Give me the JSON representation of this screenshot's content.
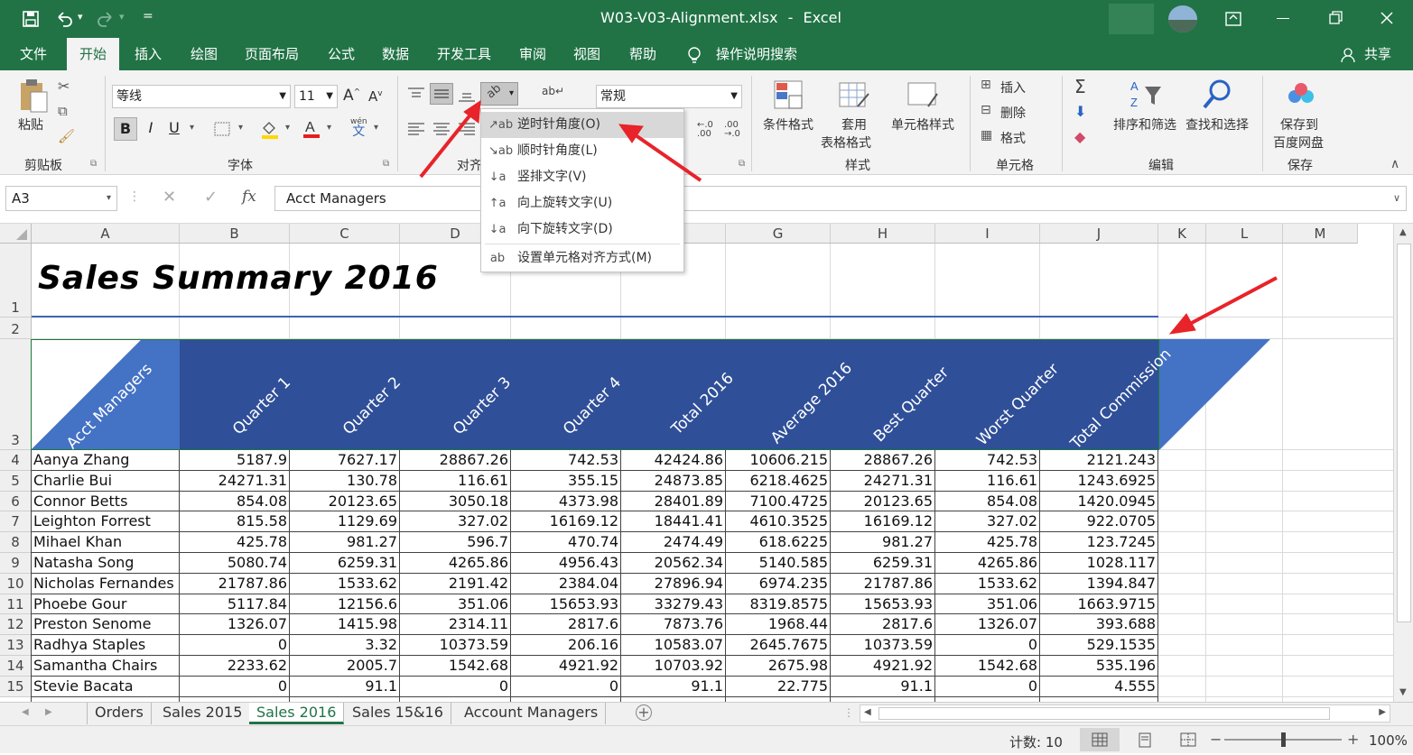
{
  "titlebar": {
    "filename": "W03-V03-Alignment.xlsx",
    "sep": "-",
    "app": "Excel",
    "quick_more": "="
  },
  "tabs": [
    "文件",
    "开始",
    "插入",
    "绘图",
    "页面布局",
    "公式",
    "数据",
    "开发工具",
    "审阅",
    "视图",
    "帮助"
  ],
  "tell_me": "操作说明搜索",
  "share": "共享",
  "ribbon": {
    "paste": "粘贴",
    "clipboard": "剪贴板",
    "font_name": "等线",
    "font_size": "11",
    "font_group": "字体",
    "bold": "B",
    "italic": "I",
    "underline": "U",
    "phonetic_top": "wén",
    "phonetic_bottom": "文",
    "align_group": "对齐",
    "number_format": "常规",
    "cond_format": "条件格式",
    "table_format_1": "套用",
    "table_format_2": "表格格式",
    "cell_style": "单元格样式",
    "styles_group": "样式",
    "insert": "插入",
    "delete": "删除",
    "format": "格式",
    "cells_group": "单元格",
    "sort_filter": "排序和筛选",
    "find_select": "查找和选择",
    "edit_group": "编辑",
    "save_to_1": "保存到",
    "save_to_2": "百度网盘",
    "save_group": "保存"
  },
  "orientation_menu": [
    {
      "label": "逆时针角度(O)",
      "icon": "↗ab"
    },
    {
      "label": "顺时针角度(L)",
      "icon": "↘ab"
    },
    {
      "label": "竖排文字(V)",
      "icon": "↓a"
    },
    {
      "label": "向上旋转文字(U)",
      "icon": "↑a"
    },
    {
      "label": "向下旋转文字(D)",
      "icon": "↓a"
    },
    {
      "label": "设置单元格对齐方式(M)",
      "icon": "ab"
    }
  ],
  "formula_bar": {
    "name_box": "A3",
    "content": "Acct Managers",
    "fx": "fx"
  },
  "columns": [
    "A",
    "B",
    "C",
    "D",
    "E",
    "F",
    "G",
    "H",
    "I",
    "J",
    "K",
    "L",
    "M"
  ],
  "row_numbers": [
    "1",
    "2",
    "3",
    "4",
    "5",
    "6",
    "7",
    "8",
    "9",
    "10",
    "11",
    "12",
    "13",
    "14",
    "15"
  ],
  "title": "Sales Summary 2016",
  "headers": [
    "Acct Managers",
    "Quarter 1",
    "Quarter 2",
    "Quarter 3",
    "Quarter 4",
    "Total 2016",
    "Average 2016",
    "Best Quarter",
    "Worst Quarter",
    "Total Commission"
  ],
  "rows": [
    [
      "Aanya Zhang",
      "5187.9",
      "7627.17",
      "28867.26",
      "742.53",
      "42424.86",
      "10606.215",
      "28867.26",
      "742.53",
      "2121.243"
    ],
    [
      "Charlie Bui",
      "24271.31",
      "130.78",
      "116.61",
      "355.15",
      "24873.85",
      "6218.4625",
      "24271.31",
      "116.61",
      "1243.6925"
    ],
    [
      "Connor Betts",
      "854.08",
      "20123.65",
      "3050.18",
      "4373.98",
      "28401.89",
      "7100.4725",
      "20123.65",
      "854.08",
      "1420.0945"
    ],
    [
      "Leighton Forrest",
      "815.58",
      "1129.69",
      "327.02",
      "16169.12",
      "18441.41",
      "4610.3525",
      "16169.12",
      "327.02",
      "922.0705"
    ],
    [
      "Mihael Khan",
      "425.78",
      "981.27",
      "596.7",
      "470.74",
      "2474.49",
      "618.6225",
      "981.27",
      "425.78",
      "123.7245"
    ],
    [
      "Natasha Song",
      "5080.74",
      "6259.31",
      "4265.86",
      "4956.43",
      "20562.34",
      "5140.585",
      "6259.31",
      "4265.86",
      "1028.117"
    ],
    [
      "Nicholas Fernandes",
      "21787.86",
      "1533.62",
      "2191.42",
      "2384.04",
      "27896.94",
      "6974.235",
      "21787.86",
      "1533.62",
      "1394.847"
    ],
    [
      "Phoebe Gour",
      "5117.84",
      "12156.6",
      "351.06",
      "15653.93",
      "33279.43",
      "8319.8575",
      "15653.93",
      "351.06",
      "1663.9715"
    ],
    [
      "Preston Senome",
      "1326.07",
      "1415.98",
      "2314.11",
      "2817.6",
      "7873.76",
      "1968.44",
      "2817.6",
      "1326.07",
      "393.688"
    ],
    [
      "Radhya Staples",
      "0",
      "3.32",
      "10373.59",
      "206.16",
      "10583.07",
      "2645.7675",
      "10373.59",
      "0",
      "529.1535"
    ],
    [
      "Samantha Chairs",
      "2233.62",
      "2005.7",
      "1542.68",
      "4921.92",
      "10703.92",
      "2675.98",
      "4921.92",
      "1542.68",
      "535.196"
    ],
    [
      "Stevie Bacata",
      "0",
      "91.1",
      "0",
      "0",
      "91.1",
      "22.775",
      "91.1",
      "0",
      "4.555"
    ]
  ],
  "sheet_tabs": [
    "Orders",
    "Sales 2015",
    "Sales 2016",
    "Sales 15&16",
    "Account Managers"
  ],
  "active_sheet": "Sales 2016",
  "status": {
    "count": "计数: 10",
    "zoom": "100%"
  },
  "colors": {
    "excel_green": "#217346",
    "header_fill": "#2f4f98",
    "accent_blue": "#4472c4",
    "arrow_red": "#e8232a"
  }
}
